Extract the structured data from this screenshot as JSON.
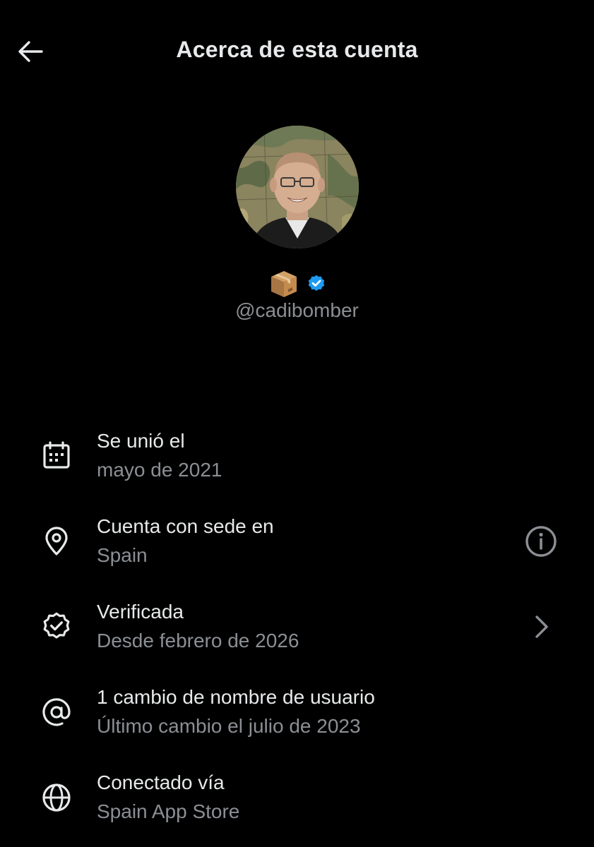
{
  "header": {
    "title": "Acerca de esta cuenta",
    "back_icon": "arrow-left-icon"
  },
  "profile": {
    "avatar": "profile-avatar",
    "badges": [
      "package-emoji-icon",
      "verified-badge-icon"
    ],
    "handle": "@cadibomber",
    "verified_color": "#1d9bf0"
  },
  "rows": [
    {
      "icon": "calendar-icon",
      "title": "Se unió el",
      "subtitle": "mayo de 2021"
    },
    {
      "icon": "location-pin-icon",
      "title": "Cuenta con sede en",
      "subtitle": "Spain",
      "action_icon": "info-icon"
    },
    {
      "icon": "verified-outline-icon",
      "title": "Verificada",
      "subtitle": "Desde febrero de 2026",
      "action_icon": "chevron-right-icon"
    },
    {
      "icon": "at-sign-icon",
      "title": "1 cambio de nombre de usuario",
      "subtitle": "Último cambio el julio de 2023"
    },
    {
      "icon": "globe-icon",
      "title": "Conectado vía",
      "subtitle": "Spain App Store"
    }
  ],
  "colors": {
    "background": "#000000",
    "primary_text": "#e7e9ea",
    "secondary_text": "#8b8f94"
  }
}
